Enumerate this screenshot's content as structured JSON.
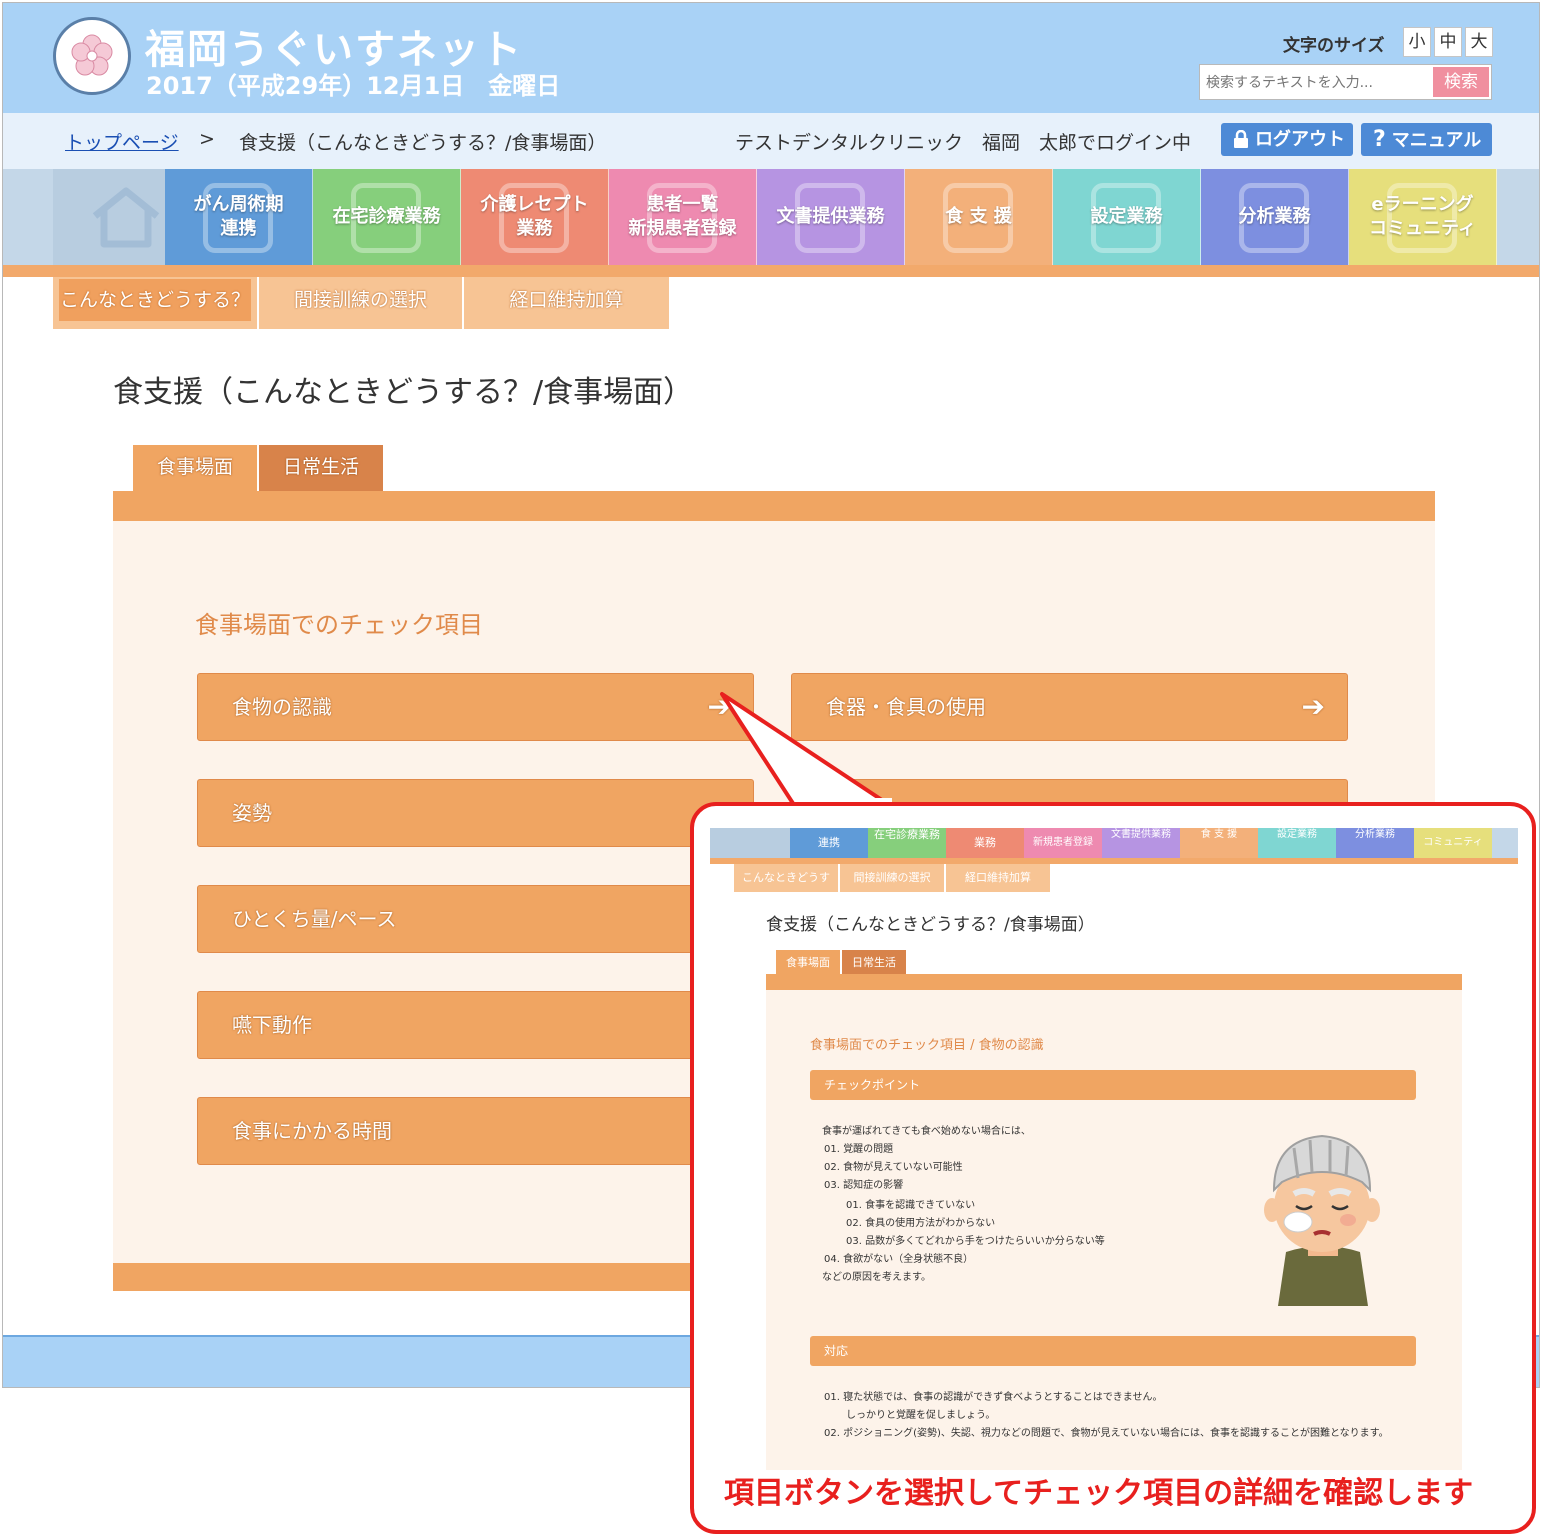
{
  "header": {
    "site_title": "福岡うぐいすネット",
    "date": "2017（平成29年）12月1日　金曜日",
    "font_size_label": "文字のサイズ",
    "font_sizes": [
      "小",
      "中",
      "大"
    ],
    "search_placeholder": "検索するテキストを入力...",
    "search_button": "検索"
  },
  "breadcrumb": {
    "top_link": "トップページ",
    "separator": ">",
    "current": "食支援（こんなときどうする？/食事場面）"
  },
  "user": {
    "login_text": "テストデンタルクリニック　福岡　太郎でログイン中",
    "logout": "ログアウト",
    "manual": "マニュアル"
  },
  "nav": {
    "items": [
      {
        "label": "",
        "color": "#b8cde0"
      },
      {
        "label": "がん周術期\n連携",
        "color": "#5f9bd8"
      },
      {
        "label": "在宅診療業務",
        "color": "#86cf7c"
      },
      {
        "label": "介護レセプト\n業務",
        "color": "#ee8a73"
      },
      {
        "label": "患者一覧\n新規患者登録",
        "color": "#ee8ab0"
      },
      {
        "label": "文書提供業務",
        "color": "#b694e2"
      },
      {
        "label": "食 支 援",
        "color": "#f3b07a"
      },
      {
        "label": "設定業務",
        "color": "#7fd6d2"
      },
      {
        "label": "分析業務",
        "color": "#7d8fe0"
      },
      {
        "label": "eラーニング\nコミュニティ",
        "color": "#e6df7c"
      }
    ]
  },
  "subtabs": [
    "こんなときどうする？",
    "間接訓練の選択",
    "経口維持加算"
  ],
  "page_title": "食支援（こんなときどうする？/食事場面）",
  "content_tabs": [
    "食事場面",
    "日常生活"
  ],
  "section_title": "食事場面でのチェック項目",
  "items": [
    "食物の認識",
    "食器・食具の使用",
    "姿勢",
    "ひとくち量/ペース",
    "嚥下動作",
    "食事にかかる時間"
  ],
  "callout": {
    "nav_labels": [
      "連携",
      "在宅診療業務",
      "業務",
      "新規患者登録",
      "文書提供業務",
      "食 支 援",
      "設定業務",
      "分析業務",
      "コミュニティ"
    ],
    "subtabs": [
      "こんなときどうする？",
      "間接訓練の選択",
      "経口維持加算"
    ],
    "page_title": "食支援（こんなときどうする？/食事場面）",
    "tabs": [
      "食事場面",
      "日常生活"
    ],
    "section_title": "食事場面でのチェック項目 / 食物の認識",
    "checkpoint_header": "チェックポイント",
    "checkpoint_lines": [
      "食事が運ばれてきても食べ始めない場合には、",
      "01. 覚醒の問題",
      "02. 食物が見えていない可能性",
      "03. 認知症の影響",
      "01. 食事を認識できていない",
      "02. 食具の使用方法がわからない",
      "03. 品数が多くてどれから手をつけたらいいか分らない等",
      "04. 食欲がない（全身状態不良）",
      "などの原因を考えます。"
    ],
    "response_header": "対応",
    "response_lines": [
      "01. 寝た状態では、食事の認識ができず食べようとすることはできません。",
      "しっかりと覚醒を促しましょう。",
      "02. ポジショニング(姿勢)、失認、視力などの問題で、食物が見えていない場合には、食事を認識することが困難となります。"
    ],
    "caption": "項目ボタンを選択してチェック項目の詳細を確認します"
  },
  "colors": {
    "header_bg": "#a9d2f6",
    "accent_orange": "#f0a562",
    "panel_bg": "#fdf3ea",
    "callout_red": "#e8201e",
    "link_blue": "#1a4fb3"
  }
}
